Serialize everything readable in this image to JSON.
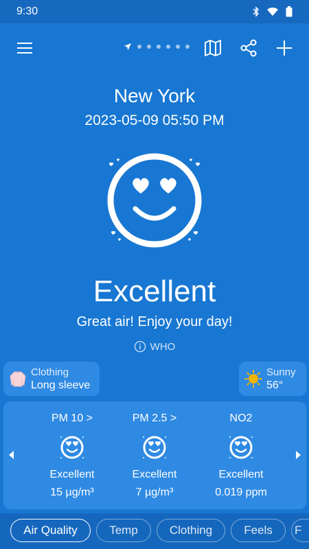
{
  "status_bar": {
    "time": "9:30"
  },
  "location": {
    "city": "New York",
    "datetime": "2023-05-09 05:50 PM"
  },
  "summary": {
    "rating": "Excellent",
    "message": "Great air! Enjoy your day!",
    "source": "WHO"
  },
  "clothing": {
    "label": "Clothing",
    "value": "Long sleeve"
  },
  "weather": {
    "label": "Sunny",
    "value": "56°"
  },
  "pollutants": [
    {
      "name": "PM 10 >",
      "status": "Excellent",
      "value": "15 µg/m³"
    },
    {
      "name": "PM 2.5 >",
      "status": "Excellent",
      "value": "7 µg/m³"
    },
    {
      "name": "NO2",
      "status": "Excellent",
      "value": "0.019 ppm"
    }
  ],
  "tabs": [
    {
      "label": "Air Quality"
    },
    {
      "label": "Temp"
    },
    {
      "label": "Clothing"
    },
    {
      "label": "Feels"
    },
    {
      "label": "F"
    }
  ],
  "colors": {
    "background": "#1877d2",
    "card": "#2f8ae3",
    "status_bar": "#1669bf",
    "tabbar": "#1567bd",
    "sun": "#f5b400"
  },
  "icons": [
    "menu-icon",
    "location-arrow-icon",
    "map-icon",
    "share-icon",
    "add-icon",
    "heart-eyes-face-icon",
    "info-icon",
    "long-sleeve-shirt-icon",
    "sun-icon",
    "chevron-left-icon",
    "chevron-right-icon"
  ]
}
